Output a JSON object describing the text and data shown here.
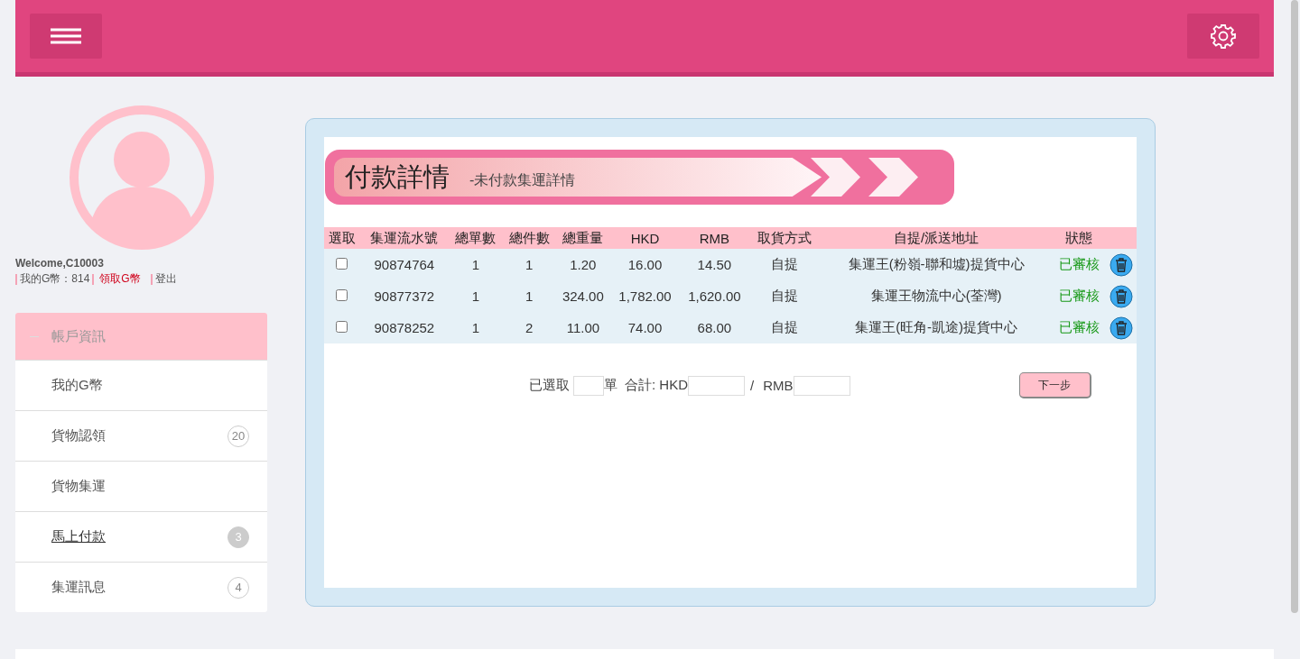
{
  "user": {
    "welcome": "Welcome,C10003",
    "coins_label": "我的G幣：814",
    "claim_link": "領取G幣",
    "logout_link": "登出"
  },
  "sidebar": {
    "items": [
      {
        "label": "帳戶資訊",
        "selected": true,
        "underlined": false
      },
      {
        "label": "我的G幣",
        "selected": false,
        "underlined": false
      },
      {
        "label": "貨物認領",
        "selected": false,
        "underlined": false,
        "badge": {
          "text": "20",
          "filled": false
        }
      },
      {
        "label": "貨物集運",
        "selected": false,
        "underlined": false
      },
      {
        "label": "馬上付款",
        "selected": false,
        "underlined": true,
        "badge": {
          "text": "3",
          "filled": true
        }
      },
      {
        "label": "集運訊息",
        "selected": false,
        "underlined": false,
        "badge": {
          "text": "4",
          "filled": false
        }
      }
    ]
  },
  "banner": {
    "title": "付款詳情",
    "subtitle": "-未付款集運詳情"
  },
  "table": {
    "columns": [
      "選取",
      "集運流水號",
      "總單數",
      "總件數",
      "總重量",
      "HKD",
      "RMB",
      "取貨方式",
      "自提/派送地址",
      "狀態"
    ],
    "rows": [
      {
        "checked": false,
        "cells": [
          "",
          "90874764",
          "1",
          "1",
          "1.20",
          "16.00",
          "14.50",
          "自提",
          "集運王(粉嶺-聯和墟)提貨中心",
          "已審核"
        ]
      },
      {
        "checked": false,
        "cells": [
          "",
          "90877372",
          "1",
          "1",
          "324.00",
          "1,782.00",
          "1,620.00",
          "自提",
          "集運王物流中心(荃灣)",
          "已審核"
        ]
      },
      {
        "checked": false,
        "cells": [
          "",
          "90878252",
          "1",
          "2",
          "11.00",
          "74.00",
          "68.00",
          "自提",
          "集運王(旺角-凱途)提貨中心",
          "已審核"
        ]
      }
    ]
  },
  "summary": {
    "selected_label": "已選取",
    "unit_label": "單",
    "total_label": "合計: HKD",
    "separator": "/",
    "rmb_label": "RMB",
    "next_button": "下一步"
  }
}
